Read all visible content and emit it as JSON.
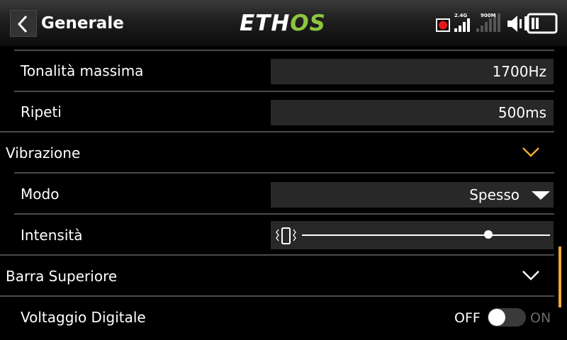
{
  "header": {
    "back_label": "back",
    "title": "Generale",
    "logo": {
      "part1": "ETH",
      "part2": "OS"
    },
    "status": {
      "rf1_label": "2.4G",
      "rf2_label": "900M"
    }
  },
  "colors": {
    "accent": "#f0a830",
    "logo_green": "#8cc63f",
    "field_bg": "#282828"
  },
  "rows": {
    "max_tone": {
      "label": "Tonalità massima",
      "value": "1700Hz"
    },
    "repeat": {
      "label": "Ripeti",
      "value": "500ms"
    },
    "vibration": {
      "label": "Vibrazione",
      "expanded": true
    },
    "mode": {
      "label": "Modo",
      "value": "Spesso"
    },
    "intensity": {
      "label": "Intensità",
      "level": 0.75
    },
    "top_bar": {
      "label": "Barra Superiore",
      "expanded": false
    },
    "digital_voltage": {
      "label": "Voltaggio Digitale",
      "off_label": "OFF",
      "on_label": "ON",
      "state": "off"
    }
  }
}
